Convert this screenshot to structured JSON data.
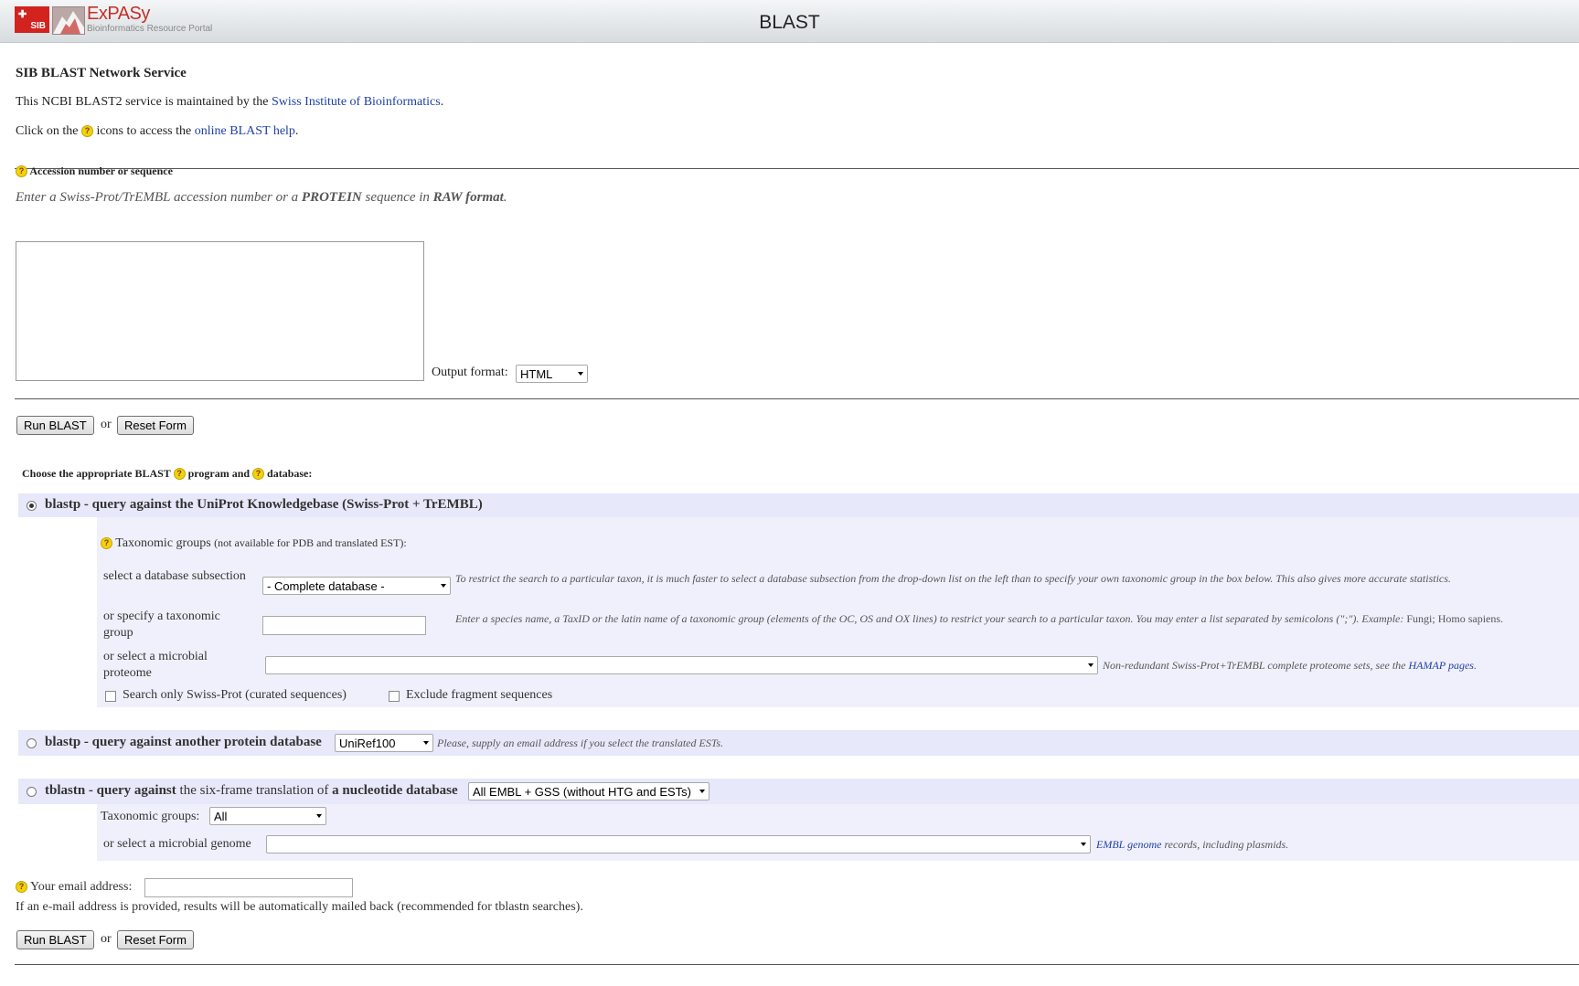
{
  "header": {
    "sib_logo": "SIB",
    "brand": "ExPASy",
    "brand_sub": "Bioinformatics Resource Portal",
    "page_title": "BLAST"
  },
  "intro": {
    "title": "SIB BLAST Network Service",
    "maintained_prefix": "This NCBI BLAST2 service is maintained by the ",
    "maintained_link": "Swiss Institute of Bioinformatics",
    "maintained_suffix": ".",
    "help_prefix": "Click on the ",
    "help_middle": " icons to access the ",
    "help_link": "online BLAST help",
    "help_suffix": "."
  },
  "accession": {
    "label": "Accession number or sequence",
    "hint_1": "Enter a Swiss-Prot/TrEMBL accession number or a ",
    "hint_bold_1": "PROTEIN",
    "hint_2": " sequence in ",
    "hint_bold_2": "RAW format",
    "hint_3": ".",
    "sequence_value": "",
    "output_format_label": "Output format:",
    "output_format_value": "HTML"
  },
  "buttons": {
    "run": "Run BLAST",
    "or": "or",
    "reset": "Reset Form"
  },
  "choose": {
    "prefix": "Choose the appropriate BLAST ",
    "middle": " program and ",
    "suffix": " database:"
  },
  "blastp_uniprot": {
    "title": "blastp - query against the UniProt Knowledgebase (Swiss-Prot + TrEMBL)",
    "selected": true,
    "taxo_label": "Taxonomic groups",
    "taxo_note": "(not available for PDB and translated EST):",
    "subsection_label": "select a database subsection",
    "subsection_value": "- Complete database -",
    "subsection_help": "To restrict the search to a particular taxon, it is much faster to select a database subsection from the drop-down list on the left than to specify your own taxonomic group in the box below. This also gives more accurate statistics.",
    "taxgroup_label": "or specify a taxonomic group",
    "taxgroup_value": "",
    "taxgroup_help_1": "Enter a species name, a TaxID or the latin name of a taxonomic group (elements of the OC, OS and OX lines) to restrict your search to a particular taxon. You may enter a list separated by semicolons (\";\"). Example: ",
    "taxgroup_help_example": "Fungi; Homo sapiens.",
    "proteome_label": "or select a microbial proteome",
    "proteome_value": "",
    "proteome_help": "Non-redundant Swiss-Prot+TrEMBL complete proteome sets, see the ",
    "proteome_link": "HAMAP pages",
    "proteome_help_end": ".",
    "swissprot_only_label": "Search only Swiss-Prot (curated sequences)",
    "swissprot_only_checked": false,
    "exclude_fragments_label": "Exclude fragment sequences",
    "exclude_fragments_checked": false
  },
  "blastp_other": {
    "title": "blastp - query against another protein database",
    "db_value": "UniRef100",
    "note": "Please, supply an email address if you select the translated ESTs.",
    "selected": false
  },
  "tblastn": {
    "title_1": "tblastn - query against",
    "title_2": " the six-frame translation of ",
    "title_3": "a nucleotide database",
    "db_value": "All EMBL + GSS (without HTG and ESTs)",
    "selected": false,
    "taxo_label": "Taxonomic groups:",
    "taxo_value": "All",
    "genome_label": "or select a microbial genome",
    "genome_value": "",
    "genome_link": "EMBL genome",
    "genome_help": " records, including plasmids."
  },
  "email": {
    "label": "Your email address:",
    "value": "",
    "note": "If an e-mail address is provided, results will be automatically mailed back (recommended for tblastn searches)."
  },
  "icons": {
    "help": "help-icon",
    "dropdown": "chevron-down-icon"
  },
  "colors": {
    "section_band": "#e8e8fb",
    "section_panel": "#f0f0fc",
    "link": "#1f3fa6",
    "brand_red": "#c2302a",
    "help_icon": "#f3d20b"
  }
}
